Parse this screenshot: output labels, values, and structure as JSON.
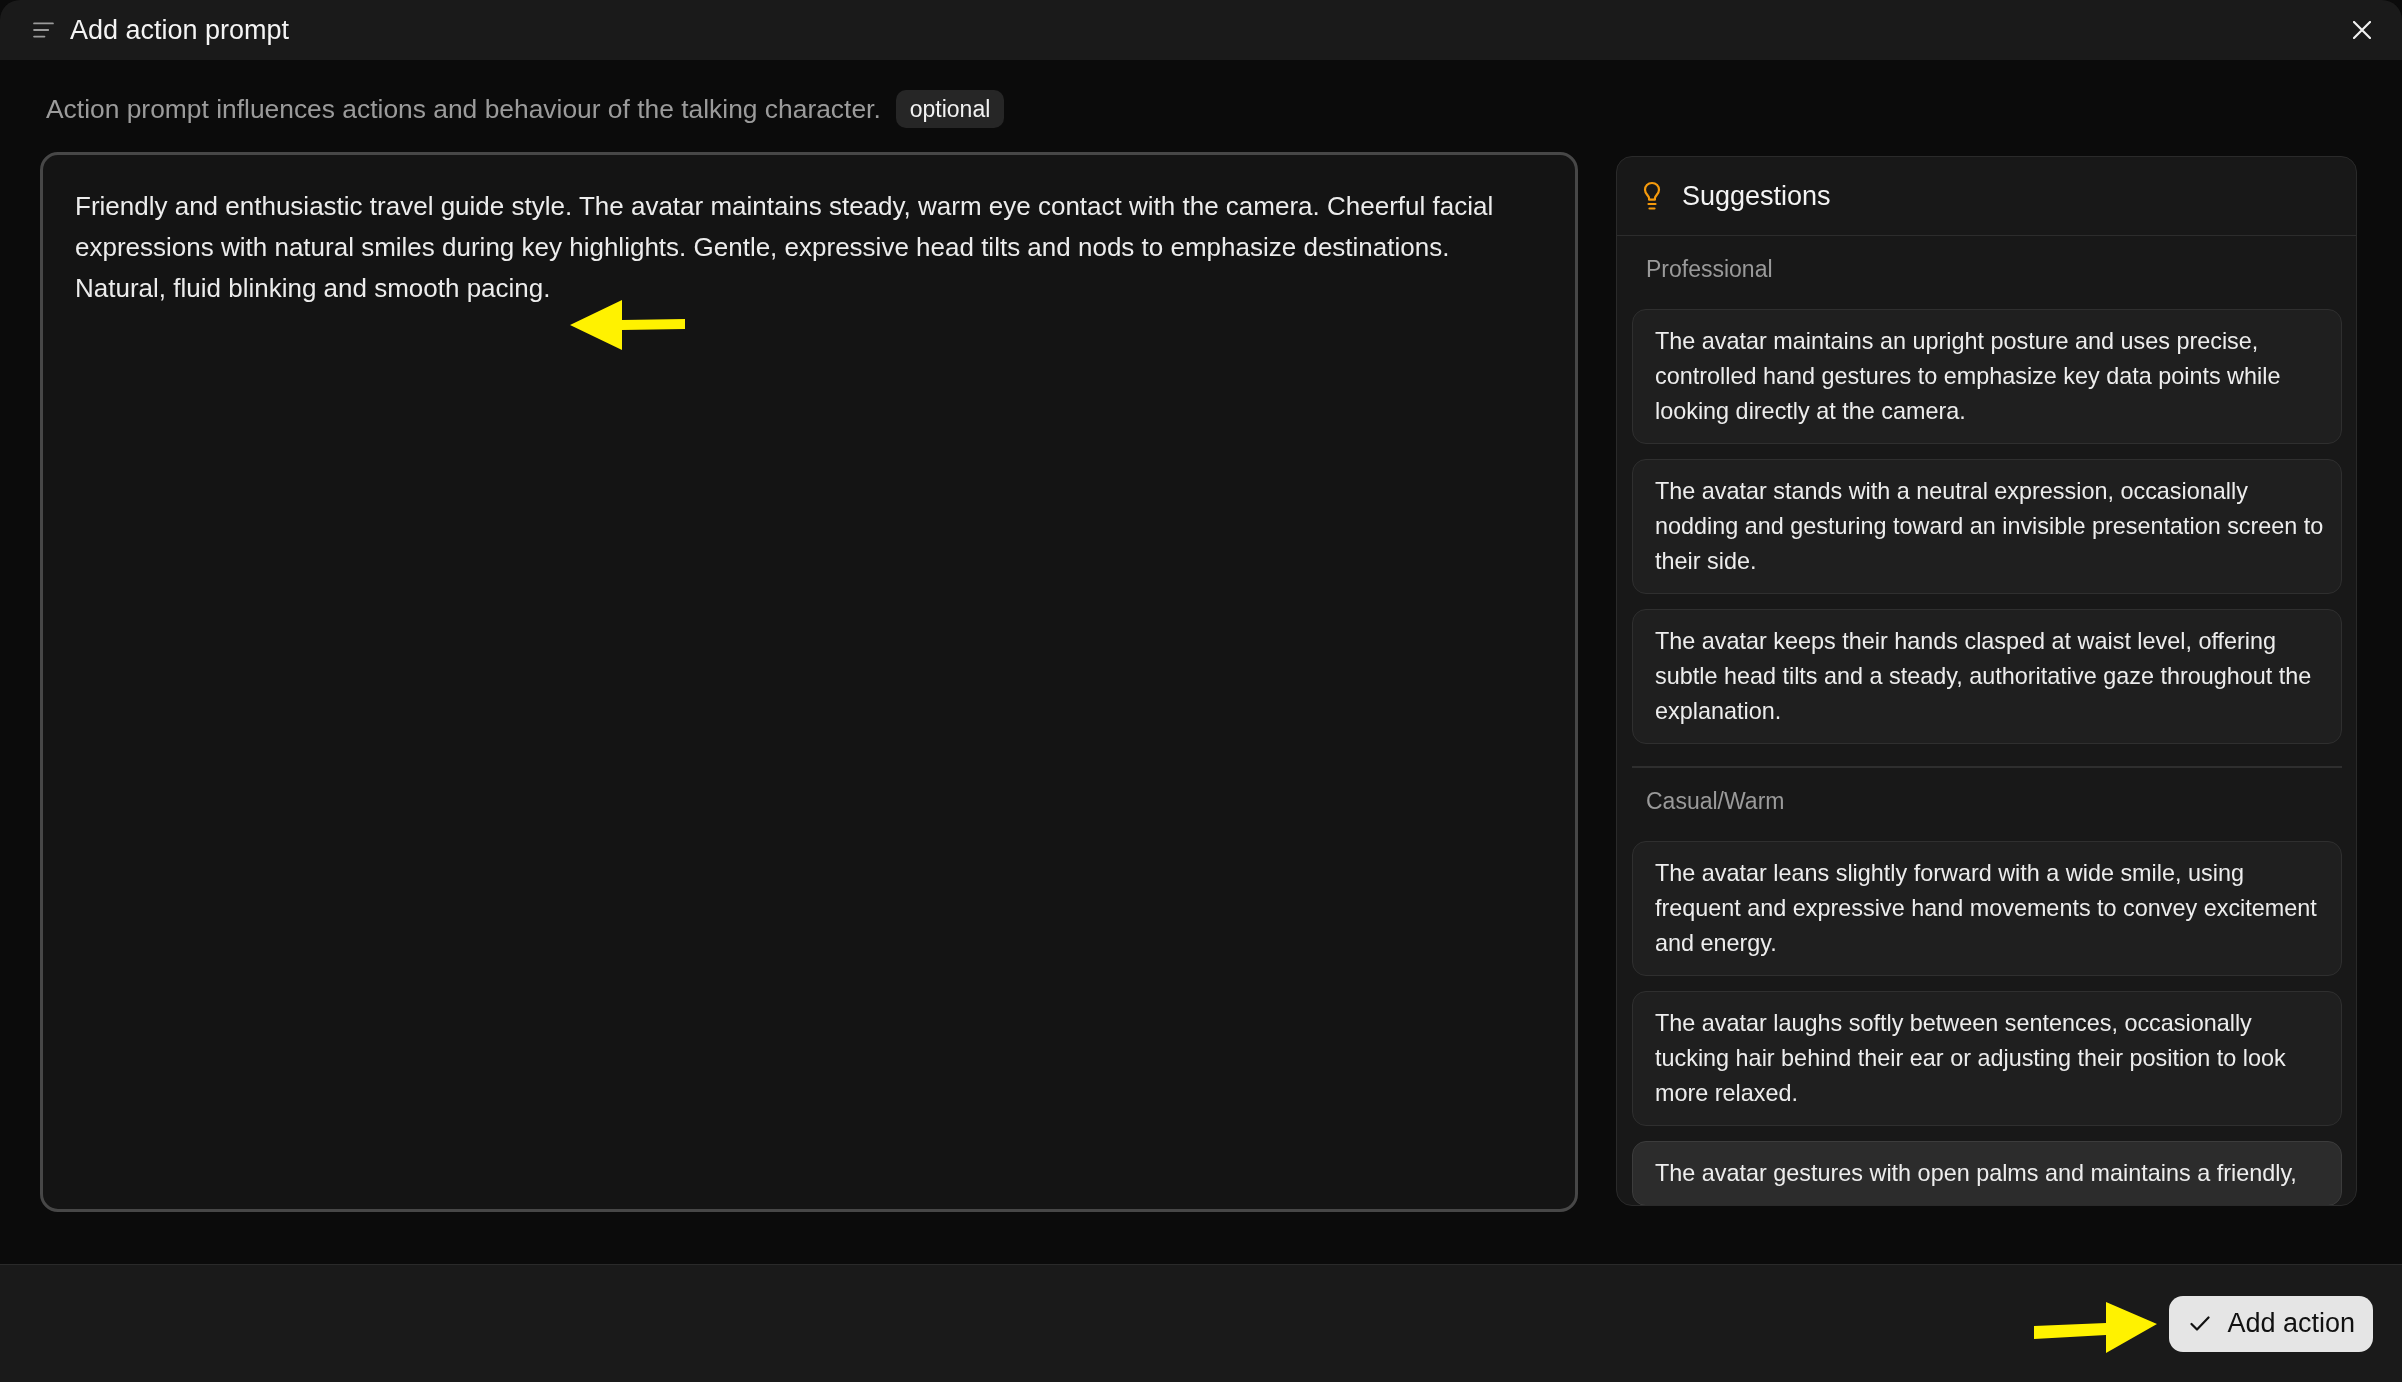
{
  "window": {
    "title": "Add action prompt"
  },
  "description": {
    "text": "Action prompt influences actions and behaviour of the talking character.",
    "badge": "optional"
  },
  "prompt": {
    "value": "Friendly and enthusiastic travel guide style. The avatar maintains steady, warm eye contact with the camera. Cheerful facial expressions with natural smiles during key highlights. Gentle, expressive head tilts and nods to emphasize destinations. Natural, fluid blinking and smooth pacing."
  },
  "suggestions": {
    "title": "Suggestions",
    "groups": [
      {
        "label": "Professional",
        "items": [
          {
            "text": "The avatar maintains an upright posture and uses precise, controlled hand gestures to emphasize key data points while looking directly at the camera.",
            "hovered": false
          },
          {
            "text": "The avatar stands with a neutral expression, occasionally nodding and gesturing toward an invisible presentation screen to their side.",
            "hovered": false
          },
          {
            "text": "The avatar keeps their hands clasped at waist level, offering subtle head tilts and a steady, authoritative gaze throughout the explanation.",
            "hovered": false
          }
        ]
      },
      {
        "label": "Casual/Warm",
        "items": [
          {
            "text": "The avatar leans slightly forward with a wide smile, using frequent and expressive hand movements to convey excitement and energy.",
            "hovered": false
          },
          {
            "text": "The avatar laughs softly between sentences, occasionally tucking hair behind their ear or adjusting their position to look more relaxed.",
            "hovered": false
          },
          {
            "text": "The avatar gestures with open palms and maintains a friendly,",
            "hovered": true
          }
        ]
      }
    ]
  },
  "footer": {
    "primary_button": "Add action"
  }
}
